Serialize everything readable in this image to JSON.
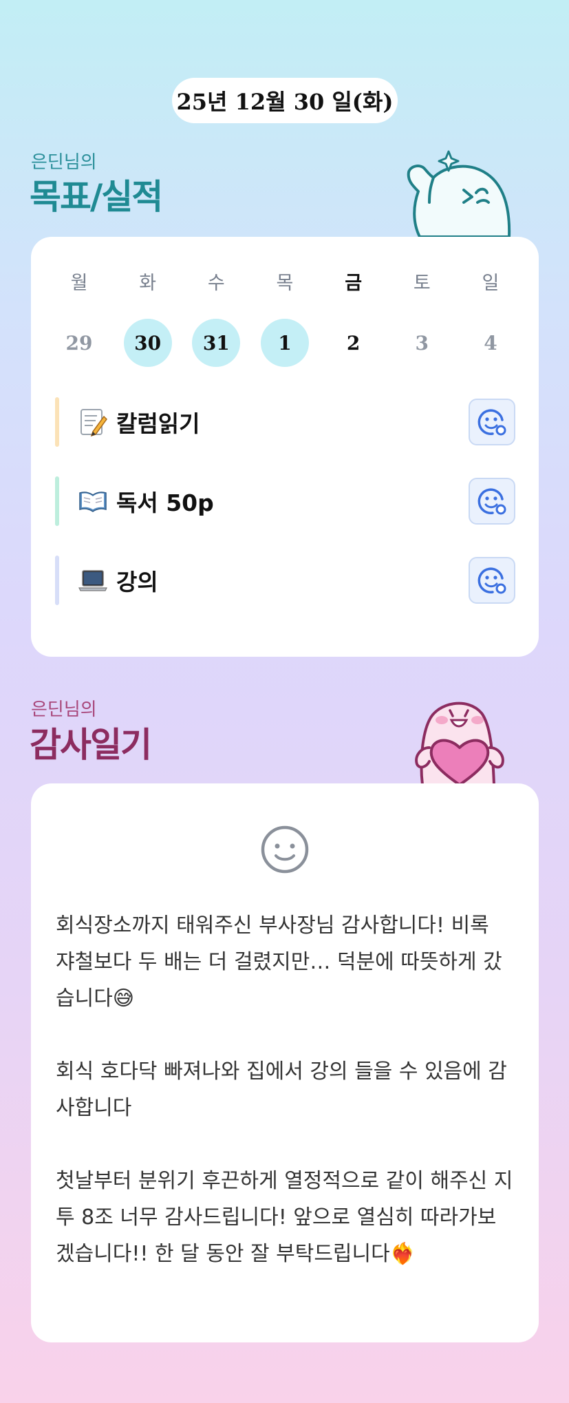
{
  "date_label": "25년 12월 30 일(화)",
  "goal_section": {
    "subtitle": "은딘님의",
    "title": "목표/실적"
  },
  "week": [
    {
      "name": "월",
      "num": "29",
      "state": "muted"
    },
    {
      "name": "화",
      "num": "30",
      "state": "done"
    },
    {
      "name": "수",
      "num": "31",
      "state": "done"
    },
    {
      "name": "목",
      "num": "1",
      "state": "done"
    },
    {
      "name": "금",
      "num": "2",
      "state": "today"
    },
    {
      "name": "토",
      "num": "3",
      "state": "muted"
    },
    {
      "name": "일",
      "num": "4",
      "state": "muted"
    }
  ],
  "goals": [
    {
      "label": "칼럼읽기",
      "icon": "memo-icon",
      "bar_color": "#fbe2b7"
    },
    {
      "label": "독서 50p",
      "icon": "book-icon",
      "bar_color": "#bdeedd"
    },
    {
      "label": "강의",
      "icon": "laptop-icon",
      "bar_color": "#d7def8"
    }
  ],
  "gratitude_section": {
    "subtitle": "은딘님의",
    "title": "감사일기"
  },
  "gratitude": {
    "paragraph1": "회식장소까지 태워주신 부사장님 감사합니다! 비록 쟈철보다 두 배는 더 걸렸지만… 덕분에 따뜻하게 갔습니다😅",
    "paragraph2": "회식 호다닥 빠져나와 집에서 강의 들을 수 있음에 감사합니다",
    "paragraph3": "첫날부터 분위기 후끈하게 열정적으로 같이 해주신 지투 8조 너무 감사드립니다! 앞으로 열심히 따라가보겠습니다!! 한 달 동안 잘 부탁드립니다❤️‍🔥"
  },
  "colors": {
    "accent_teal": "#1f8a93",
    "accent_plum": "#8c2c60",
    "done_day": "#c4eff6",
    "react_blue": "#3a6fe0"
  },
  "icons": [
    "sparkle-icon",
    "smiley-icon",
    "add-reaction-icon"
  ]
}
